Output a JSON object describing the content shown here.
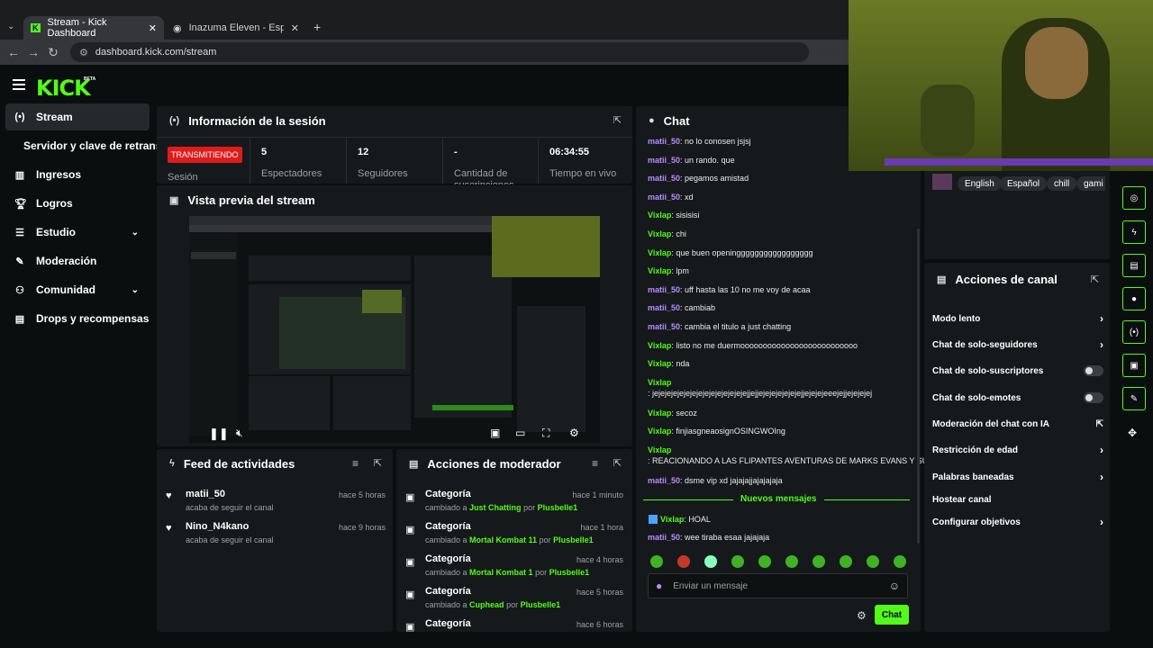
{
  "browser": {
    "tabs": [
      {
        "label": "Stream - Kick Dashboard",
        "active": true
      },
      {
        "label": "Inazuma Eleven - Español (Esp",
        "active": false
      }
    ],
    "url": "dashboard.kick.com/stream"
  },
  "brand": {
    "logo": "KICK",
    "beta": "BETA",
    "accent": "#53fc18"
  },
  "sidebar": {
    "items": [
      {
        "label": "Stream",
        "icon": "broadcast-icon"
      },
      {
        "label": "Servidor y clave de retransn",
        "icon": ""
      },
      {
        "label": "Ingresos",
        "icon": "chart-icon"
      },
      {
        "label": "Logros",
        "icon": "trophy-icon"
      },
      {
        "label": "Estudio",
        "icon": "studio-icon"
      },
      {
        "label": "Moderación",
        "icon": "wrench-icon"
      },
      {
        "label": "Comunidad",
        "icon": "people-icon"
      },
      {
        "label": "Drops y recompensas",
        "icon": "gift-icon"
      }
    ]
  },
  "session": {
    "title": "Información de la sesión",
    "status_badge": "TRANSMITIENDO",
    "status_label": "Sesión",
    "stats": [
      {
        "value": "5",
        "label": "Espectadores"
      },
      {
        "value": "12",
        "label": "Seguidores"
      },
      {
        "value": "-",
        "label": "Cantidad de suscripciones"
      },
      {
        "value": "06:34:55",
        "label": "Tiempo en vivo"
      }
    ]
  },
  "preview": {
    "title": "Vista previa del stream"
  },
  "feed": {
    "title": "Feed de actividades",
    "items": [
      {
        "name": "matii_50",
        "sub": "acaba de seguir el canal",
        "time": "hace 5 horas"
      },
      {
        "name": "Nino_N4kano",
        "sub": "acaba de seguir el canal",
        "time": "hace 9 horas"
      }
    ]
  },
  "modactions": {
    "title": "Acciones de moderador",
    "prefix": "cambiado a",
    "by": "por",
    "items": [
      {
        "name": "Categoría",
        "target": "Just Chatting",
        "user": "Plusbelle1",
        "time": "hace 1 minuto"
      },
      {
        "name": "Categoría",
        "target": "Mortal Kombat 11",
        "user": "Plusbelle1",
        "time": "hace 1 hora"
      },
      {
        "name": "Categoría",
        "target": "Mortal Kombat 1",
        "user": "Plusbelle1",
        "time": "hace 4 horas"
      },
      {
        "name": "Categoría",
        "target": "Cuphead",
        "user": "Plusbelle1",
        "time": "hace 5 horas"
      },
      {
        "name": "Categoría",
        "target": "",
        "user": "",
        "time": "hace 6 horas"
      }
    ]
  },
  "chat": {
    "title": "Chat",
    "new_messages": "Nuevos mensajes",
    "placeholder": "Enviar un mensaje",
    "send": "Chat",
    "messages": [
      {
        "user": "matii_50",
        "text": ": no lo conosen jsjsj",
        "c": "u1"
      },
      {
        "user": "matii_50",
        "text": ": un rando. que",
        "c": "u1"
      },
      {
        "user": "matii_50",
        "text": ": pegamos amistad",
        "c": "u1"
      },
      {
        "user": "matii_50",
        "text": ": xd",
        "c": "u1"
      },
      {
        "user": "Vixlap",
        "text": ": sisisisi",
        "c": "u2"
      },
      {
        "user": "Vixlap",
        "text": ": chi",
        "c": "u2"
      },
      {
        "user": "Vixlap",
        "text": ": que buen openinggggggggggggggggg",
        "c": "u2"
      },
      {
        "user": "Vixlap",
        "text": ": lpm",
        "c": "u2"
      },
      {
        "user": "matii_50",
        "text": ": uff hasta las 10 no me voy de acaa",
        "c": "u1"
      },
      {
        "user": "matii_50",
        "text": ": cambiab",
        "c": "u1"
      },
      {
        "user": "matii_50",
        "text": ": cambia el titulo a just chatting",
        "c": "u1"
      },
      {
        "user": "Vixlap",
        "text": ": listo no me duermoooooooooooooooooooooooooo",
        "c": "u2"
      },
      {
        "user": "Vixlap",
        "text": ": nda",
        "c": "u2"
      },
      {
        "user": "Vixlap",
        "text": ": jejejejejejejejejejejejejejejejjejjejejejejejejejjejejejeeejejjejejejej",
        "c": "u2"
      },
      {
        "user": "Vixlap",
        "text": ": secoz",
        "c": "u2"
      },
      {
        "user": "Vixlap",
        "text": ": finjiasgneaosignOSINGWOIng",
        "c": "u2"
      },
      {
        "user": "Vixlap",
        "text": ": REACIONANDO A LAS FLIPANTES AVENTURAS DE MARKS EVANS Y SU COMPAÑEROS JAJA",
        "c": "u2"
      },
      {
        "user": "matii_50",
        "text": ": dsme vip xd jajajajjajajajaja",
        "c": "u1"
      }
    ],
    "after": [
      {
        "user": "Vixlap",
        "text": ": HOAL",
        "c": "u2"
      },
      {
        "user": "matii_50",
        "text": ": wee tiraba esaa jajajaja",
        "c": "u1"
      }
    ]
  },
  "channel_tags": [
    "English",
    "Español",
    "chill",
    "gami"
  ],
  "channel_actions": {
    "title": "Acciones de canal",
    "items": [
      {
        "label": "Modo lento",
        "control": "chevron"
      },
      {
        "label": "Chat de solo-seguidores",
        "control": "chevron"
      },
      {
        "label": "Chat de solo-suscriptores",
        "control": "toggle"
      },
      {
        "label": "Chat de solo-emotes",
        "control": "toggle"
      },
      {
        "label": "Moderación del chat con IA",
        "control": "link"
      },
      {
        "label": "Restricción de edad",
        "control": "chevron"
      },
      {
        "label": "Palabras baneadas",
        "control": "chevron"
      },
      {
        "label": "Hostear canal",
        "control": "none"
      },
      {
        "label": "Configurar objetivos",
        "control": "chevron"
      }
    ]
  }
}
